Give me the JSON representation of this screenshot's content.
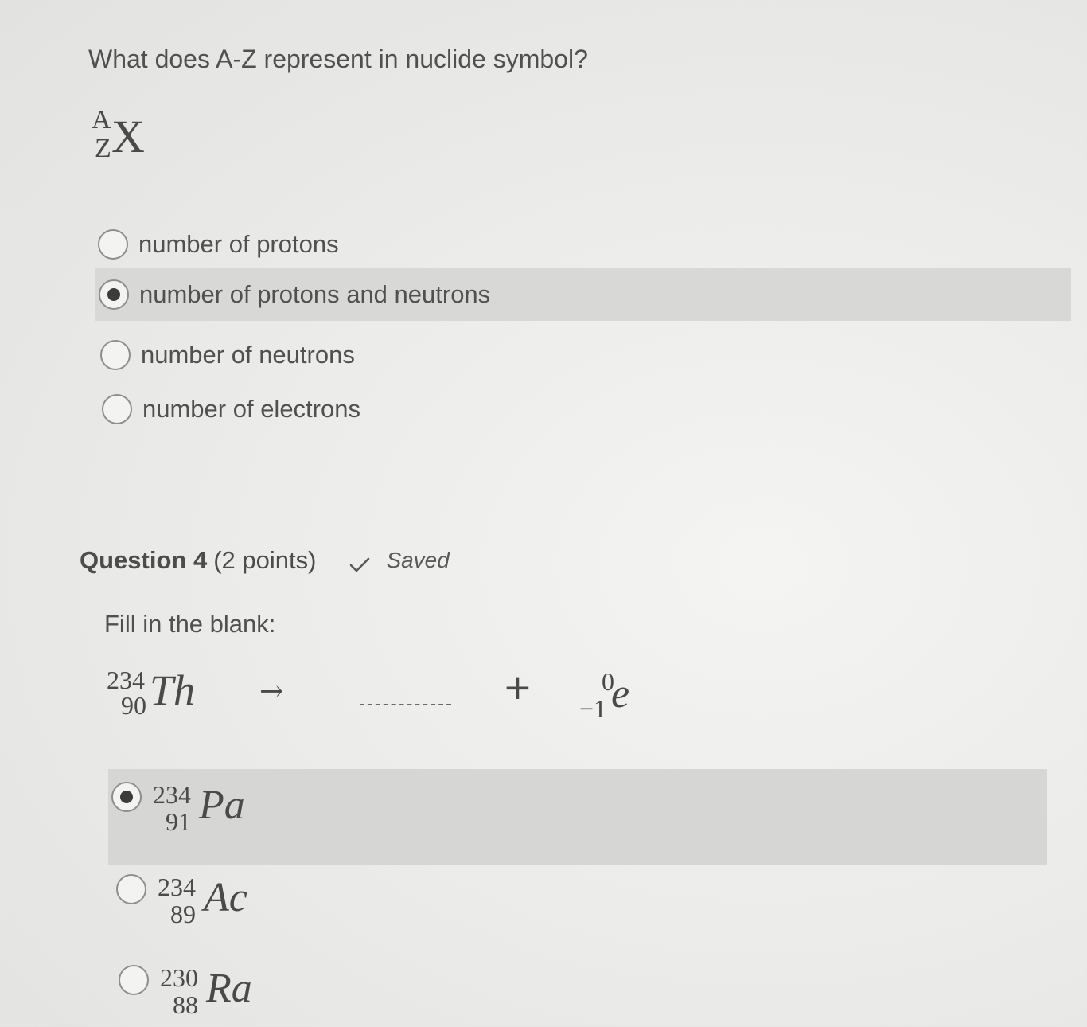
{
  "question3": {
    "text": "What does A-Z represent in nuclide symbol?",
    "nuclide": {
      "mass": "A",
      "atomic": "Z",
      "symbol": "X"
    },
    "options": [
      {
        "label": "number of protons",
        "selected": false
      },
      {
        "label": "number of protons and neutrons",
        "selected": true
      },
      {
        "label": "number of neutrons",
        "selected": false
      },
      {
        "label": "number of electrons",
        "selected": false
      }
    ]
  },
  "question4": {
    "title": "Question 4",
    "points": "(2 points)",
    "status": "Saved",
    "status_icon": "check-icon",
    "prompt": "Fill in the blank:",
    "equation": {
      "reactant": {
        "mass": "234",
        "atomic": "90",
        "symbol": "Th"
      },
      "arrow": "→",
      "plus": "+",
      "product": {
        "mass": "0",
        "atomic": "−1",
        "symbol": "e"
      }
    },
    "options": [
      {
        "mass": "234",
        "atomic": "91",
        "symbol": "Pa",
        "selected": true
      },
      {
        "mass": "234",
        "atomic": "89",
        "symbol": "Ac",
        "selected": false
      },
      {
        "mass": "230",
        "atomic": "88",
        "symbol": "Ra",
        "selected": false
      }
    ]
  }
}
